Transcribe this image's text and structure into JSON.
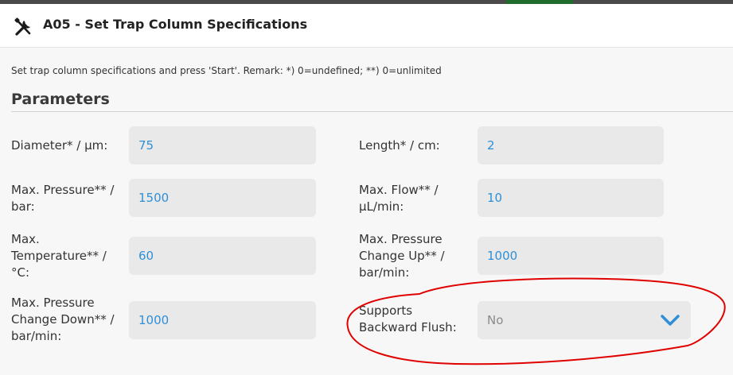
{
  "dialog": {
    "title": "A05 - Set Trap Column Specifications",
    "description": "Set trap column specifications and press 'Start'. Remark: *) 0=undefined; **) 0=unlimited",
    "section_title": "Parameters"
  },
  "params": {
    "diameter": {
      "label": "Diameter* / µm:",
      "value": "75"
    },
    "length": {
      "label": "Length* / cm:",
      "value": "2"
    },
    "max_pressure": {
      "label_l1": "Max. Pressure** /",
      "label_l2": "bar:",
      "value": "1500"
    },
    "max_flow": {
      "label_l1": "Max. Flow** /",
      "label_l2": "µL/min:",
      "value": "10"
    },
    "max_temperature": {
      "label_l1": "Max.",
      "label_l2": "Temperature** /",
      "label_l3": "°C:",
      "value": "60"
    },
    "max_pressure_change_up": {
      "label_l1": "Max. Pressure",
      "label_l2": "Change Up** /",
      "label_l3": "bar/min:",
      "value": "1000"
    },
    "max_pressure_change_down": {
      "label_l1": "Max. Pressure",
      "label_l2": "Change Down** /",
      "label_l3": "bar/min:",
      "value": "1000"
    },
    "supports_backward_flush": {
      "label_l1": "Supports",
      "label_l2": "Backward Flush:",
      "selected": "No"
    }
  },
  "colors": {
    "value_text": "#2f8fd6",
    "chevron": "#2f8fd6",
    "annotation": "#e00000"
  },
  "icons": {
    "header": "tools-icon",
    "select": "chevron-down-icon"
  }
}
